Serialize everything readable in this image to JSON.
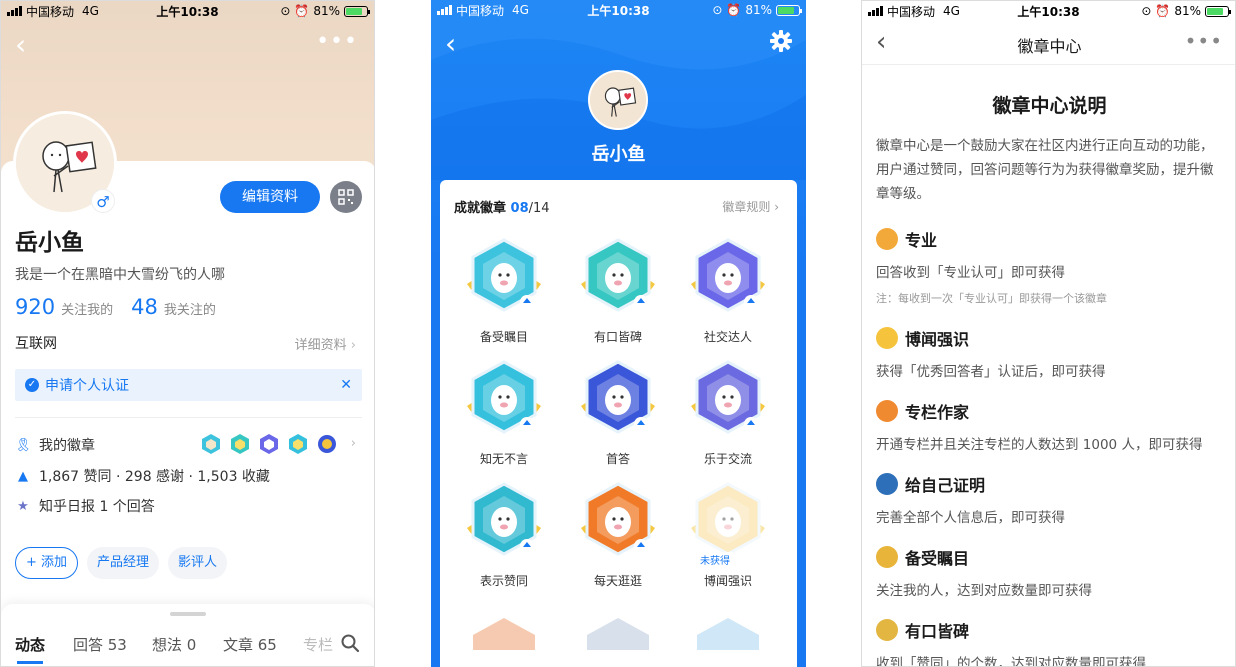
{
  "status": {
    "carrier": "中国移动",
    "network": "4G",
    "time": "上午10:38",
    "battery": "81%"
  },
  "colors": {
    "accent": "#1778f2",
    "badge_panel_bg": "#1778f2"
  },
  "profile": {
    "edit_label": "编辑资料",
    "name": "岳小鱼",
    "bio": "我是一个在黑暗中大雪纷飞的人哪",
    "followers": "920",
    "followers_label": "关注我的",
    "following": "48",
    "following_label": "我关注的",
    "industry": "互联网",
    "detail_link": "详细资料",
    "verify_label": "申请个人认证",
    "badges_label": "我的徽章",
    "stats_line": "1,867 赞同 · 298 感谢 · 1,503 收藏",
    "daily_label": "知乎日报 1 个回答",
    "tags": [
      "+ 添加",
      "产品经理",
      "影评人"
    ],
    "tabs": [
      {
        "label": "动态",
        "active": true
      },
      {
        "label": "回答 53",
        "active": false
      },
      {
        "label": "想法 0",
        "active": false
      },
      {
        "label": "文章 65",
        "active": false
      },
      {
        "label": "专栏",
        "active": false
      }
    ]
  },
  "badges_page": {
    "user_name": "岳小鱼",
    "section_title": "成就徽章",
    "earned": "08",
    "total": "/14",
    "rules_link": "徽章规则",
    "locked_label": "未获得",
    "badges": [
      {
        "label": "备受瞩目",
        "color": "#3ec3de",
        "locked": false
      },
      {
        "label": "有口皆碑",
        "color": "#36c7c2",
        "locked": false
      },
      {
        "label": "社交达人",
        "color": "#6a68e8",
        "locked": false
      },
      {
        "label": "知无不言",
        "color": "#35c1dd",
        "locked": false
      },
      {
        "label": "首答",
        "color": "#3b57d9",
        "locked": false
      },
      {
        "label": "乐于交流",
        "color": "#6b6ae0",
        "locked": false
      },
      {
        "label": "表示赞同",
        "color": "#31b9cf",
        "locked": false
      },
      {
        "label": "每天逛逛",
        "color": "#f07a28",
        "locked": false
      },
      {
        "label": "博闻强识",
        "color": "#f7d17a",
        "locked": true
      }
    ]
  },
  "badge_center": {
    "title": "徽章中心",
    "heading": "徽章中心说明",
    "intro": "徽章中心是一个鼓励大家在社区内进行正向互动的功能，用户通过赞同，回答问题等行为为获得徽章奖励，提升徽章等级。",
    "sections": [
      {
        "name": "专业",
        "desc": "回答收到「专业认可」即可获得",
        "note": "注：每收到一次「专业认可」即获得一个该徽章",
        "color": "#f3a93a"
      },
      {
        "name": "博闻强识",
        "desc": "获得「优秀回答者」认证后，即可获得",
        "note": "",
        "color": "#f5c43c"
      },
      {
        "name": "专栏作家",
        "desc": "开通专栏并且关注专栏的人数达到 1000 人，即可获得",
        "note": "",
        "color": "#f08a30"
      },
      {
        "name": "给自己证明",
        "desc": "完善全部个人信息后，即可获得",
        "note": "",
        "color": "#2d6fb8"
      },
      {
        "name": "备受瞩目",
        "desc": "关注我的人，达到对应数量即可获得",
        "note": "",
        "color": "#e8b43a"
      },
      {
        "name": "有口皆碑",
        "desc": "收到「赞同」的个数，达到对应数量即可获得",
        "note": "",
        "color": "#e2b640"
      }
    ]
  }
}
